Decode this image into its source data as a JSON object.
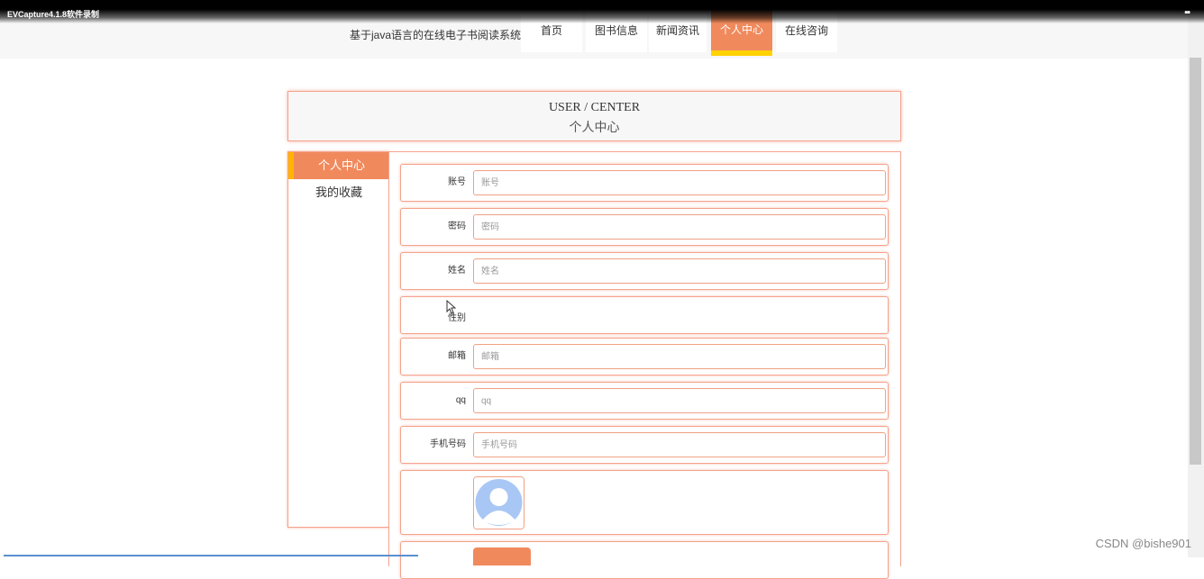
{
  "recorder": {
    "title": "EVCapture4.1.8软件录制",
    "grip": "▪▪"
  },
  "site": {
    "title": "基于java语言的在线电子书阅读系统"
  },
  "nav": {
    "items": [
      {
        "label": "首页"
      },
      {
        "label": "图书信息"
      },
      {
        "label": "新闻资讯"
      },
      {
        "label": "个人中心",
        "active": true
      },
      {
        "label": "在线咨询"
      }
    ]
  },
  "header": {
    "en": "USER / CENTER",
    "cn": "个人中心"
  },
  "sidebar": {
    "items": [
      {
        "label": "个人中心",
        "active": true
      },
      {
        "label": "我的收藏"
      }
    ]
  },
  "form": {
    "fields": [
      {
        "label": "账号",
        "placeholder": "账号"
      },
      {
        "label": "密码",
        "placeholder": "密码"
      },
      {
        "label": "姓名",
        "placeholder": "姓名"
      },
      {
        "label": "性别"
      },
      {
        "label": "邮箱",
        "placeholder": "邮箱"
      },
      {
        "label": "qq",
        "placeholder": "qq"
      },
      {
        "label": "手机号码",
        "placeholder": "手机号码"
      }
    ]
  },
  "colors": {
    "accent": "#f08a5d",
    "accent_bar": "#ffd200",
    "border": "#f5a28c",
    "avatar": "#a9c7f5"
  },
  "watermark": "CSDN @bishe901"
}
